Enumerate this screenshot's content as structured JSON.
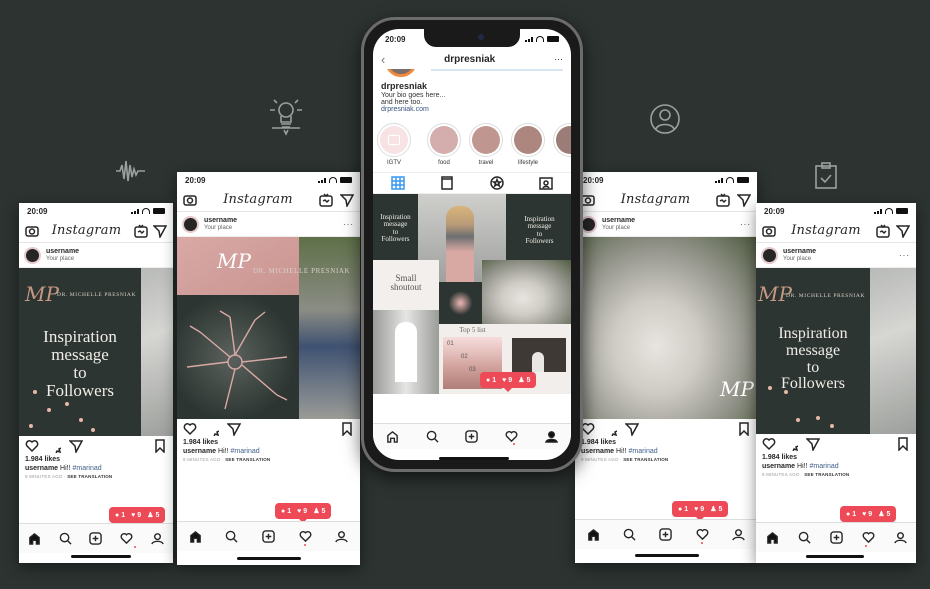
{
  "decor_icons": [
    "soundwave-icon",
    "lightbulb-icon",
    "user-circle-icon",
    "clipboard-check-icon"
  ],
  "common": {
    "time": "20:09",
    "app_name": "Instagram",
    "username": "username",
    "place": "Your place",
    "likes": "1.984 likes",
    "caption_user": "username",
    "caption_text": "Hi!!",
    "hashtag": "#marinad",
    "time_ago": "9 MINUTES AGO",
    "see_translation": "SEE TRANSLATION",
    "brand_name": "DR. MICHELLE PRESNIAK",
    "monogram": "MP",
    "quote_lines": [
      "Inspiration",
      "message",
      "to",
      "Followers"
    ],
    "notifications": {
      "comments": "1",
      "likes": "9",
      "followers": "5"
    },
    "accent_color": "#ed4956"
  },
  "profile": {
    "handle": "drpresniak",
    "display_name": "drpresniak",
    "bio_line1": "Your bio goes here...",
    "bio_line2": "and here too.",
    "website": "drpresniak.com",
    "highlights": [
      {
        "label": "IGTV",
        "color": "#f7e3e4"
      },
      {
        "label": "food",
        "color": "#d4aeac"
      },
      {
        "label": "travel",
        "color": "#c09790"
      },
      {
        "label": "lifestyle",
        "color": "#ad8680"
      }
    ],
    "grid_texts": {
      "quote_lines": [
        "Inspiration",
        "message",
        "to",
        "Followers"
      ],
      "shoutout": [
        "Small",
        "shoutout"
      ],
      "top_list_title": "Top 5 list",
      "list_items": [
        "01",
        "02",
        "03"
      ]
    }
  }
}
